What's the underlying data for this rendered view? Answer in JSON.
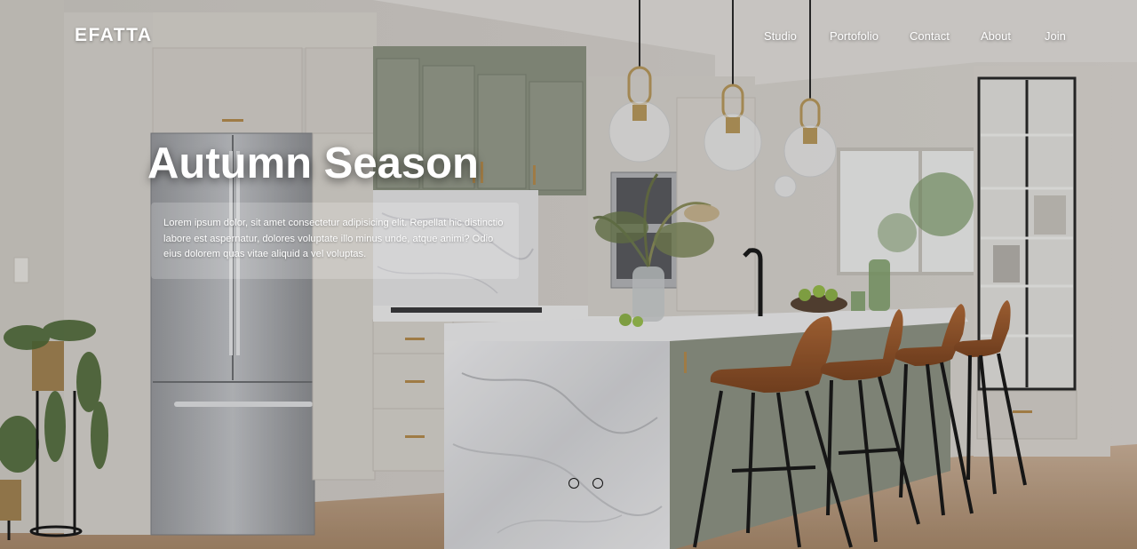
{
  "brand": {
    "logo_text": "EFATTA"
  },
  "nav": {
    "items": [
      {
        "label": "Studio"
      },
      {
        "label": "Portofolio"
      },
      {
        "label": "Contact"
      },
      {
        "label": "About"
      },
      {
        "label": "Join"
      }
    ]
  },
  "hero": {
    "title": "Autumn Season",
    "description": "Lorem ipsum dolor, sit amet consectetur adipisicing elit. Repellat hic distinctio labore est aspernatur, dolores voluptate illo minus unde, atque animi? Odio eius dolorem quas vitae aliquid a vel voluptas.",
    "slides": {
      "count": 2
    }
  },
  "colors": {
    "text": "#ffffff",
    "cabinet": "#d8d3cc",
    "upper_cabinet_green": "#8b9180",
    "stool_leather": "#9a5a2e",
    "floor": "#b8977a",
    "marble": "#e7e7e9"
  }
}
